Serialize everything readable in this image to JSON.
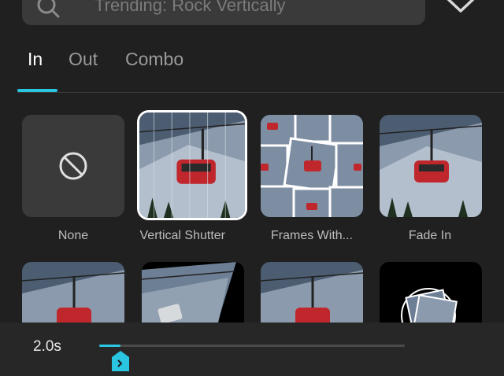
{
  "search": {
    "placeholder": "Trending: Rock Vertically"
  },
  "tabs": [
    {
      "label": "In",
      "active": true
    },
    {
      "label": "Out",
      "active": false
    },
    {
      "label": "Combo",
      "active": false
    }
  ],
  "effects": [
    {
      "label": "None",
      "thumb": "none"
    },
    {
      "label": "Vertical Shutter",
      "thumb": "gondola",
      "selected": true
    },
    {
      "label": "Frames With...",
      "thumb": "frames"
    },
    {
      "label": "Fade In",
      "thumb": "gondola"
    },
    {
      "label": "",
      "thumb": "gondola"
    },
    {
      "label": "",
      "thumb": "skewed"
    },
    {
      "label": "",
      "thumb": "gondola"
    },
    {
      "label": "",
      "thumb": "rotating-frames"
    }
  ],
  "duration": {
    "label": "2.0s",
    "progress": 0.07
  },
  "colors": {
    "accent": "#29c5e1",
    "background": "#202020",
    "tile": "#3a3a3a",
    "gondola": "#c0272d"
  }
}
